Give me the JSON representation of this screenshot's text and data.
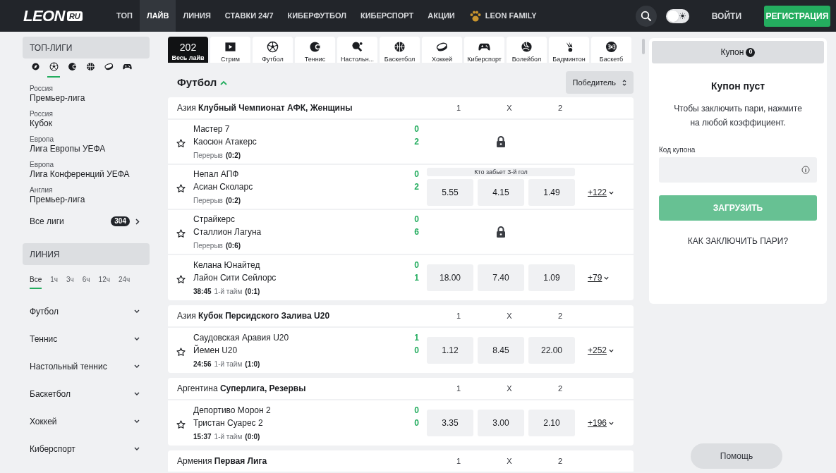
{
  "header": {
    "logo": "LEON",
    "logo_badge": "RU",
    "nav": [
      {
        "label": "ТОП",
        "selected": false
      },
      {
        "label": "ЛАЙВ",
        "selected": true
      },
      {
        "label": "ЛИНИЯ",
        "selected": false
      },
      {
        "label": "СТАВКИ 24/7",
        "selected": false
      },
      {
        "label": "КИБЕРФУТБОЛ",
        "selected": false
      },
      {
        "label": "КИБЕРСПОРТ",
        "selected": false
      },
      {
        "label": "АКЦИИ",
        "selected": false
      },
      {
        "label": "LEON FAMILY",
        "selected": false,
        "kind": "family"
      }
    ],
    "theme_toggle": {
      "on": false
    },
    "login": "ВОЙТИ",
    "register": "РЕГИСТРАЦИЯ"
  },
  "sidebar": {
    "top_leagues_title": "ТОП-ЛИГИ",
    "sport_filter": [
      {
        "kind": "other",
        "selected": false
      },
      {
        "kind": "football",
        "selected": true
      },
      {
        "kind": "tennis",
        "selected": false
      },
      {
        "kind": "basketball",
        "selected": false
      },
      {
        "kind": "hockey",
        "selected": false
      },
      {
        "kind": "esports",
        "selected": false
      }
    ],
    "leagues": [
      {
        "country": "Россия",
        "name": "Премьер-лига"
      },
      {
        "country": "Россия",
        "name": "Кубок"
      },
      {
        "country": "Европа",
        "name": "Лига Европы УЕФА"
      },
      {
        "country": "Европа",
        "name": "Лига Конференций УЕФА"
      },
      {
        "country": "Англия",
        "name": "Премьер-лига"
      }
    ],
    "all_leagues": {
      "label": "Все лиги",
      "count": "304"
    },
    "line_title": "ЛИНИЯ",
    "periods": [
      {
        "label": "Все",
        "selected": true
      },
      {
        "label": "1ч",
        "selected": false
      },
      {
        "label": "3ч",
        "selected": false
      },
      {
        "label": "6ч",
        "selected": false
      },
      {
        "label": "12ч",
        "selected": false
      },
      {
        "label": "24ч",
        "selected": false
      }
    ],
    "sports": [
      {
        "label": "Футбол",
        "expanded": false
      },
      {
        "label": "Теннис",
        "expanded": false
      },
      {
        "label": "Настольный теннис",
        "expanded": false
      },
      {
        "label": "Баскетбол",
        "expanded": false
      },
      {
        "label": "Хоккей",
        "expanded": false
      },
      {
        "label": "Киберспорт",
        "expanded": false
      }
    ]
  },
  "sport_tabs": [
    {
      "kind": "all",
      "count": "202",
      "label": "Весь лайв",
      "selected": true
    },
    {
      "kind": "stream",
      "label": "Стрим",
      "selected": false
    },
    {
      "kind": "football",
      "label": "Футбол",
      "selected": false
    },
    {
      "kind": "tennis",
      "label": "Теннис",
      "selected": false
    },
    {
      "kind": "tabletennis",
      "label": "Настольн...",
      "selected": false
    },
    {
      "kind": "basketball",
      "label": "Баскетбол",
      "selected": false
    },
    {
      "kind": "hockey",
      "label": "Хоккей",
      "selected": false
    },
    {
      "kind": "esports",
      "label": "Киберспорт",
      "selected": false
    },
    {
      "kind": "volleyball",
      "label": "Волейбол",
      "selected": false
    },
    {
      "kind": "badminton",
      "label": "Бадминтон",
      "selected": false
    },
    {
      "kind": "threebythree",
      "label": "Баскетб",
      "selected": false
    }
  ],
  "section": {
    "title": "Футбол",
    "expanded": true,
    "market_select": "Победитель"
  },
  "leagues": [
    {
      "country": "Азия",
      "name": "Клубный Чемпионат АФК, Женщины",
      "columns": [
        "1",
        "X",
        "2"
      ],
      "matches": [
        {
          "team1": "Мастер 7",
          "team2": "Каосюн Атакерс",
          "score1": "0",
          "score2": "2",
          "period": "Перерыв",
          "period_score": "(0:2)",
          "locked": true
        },
        {
          "team1": "Непал АПФ",
          "team2": "Асиан Сколарс",
          "score1": "0",
          "score2": "2",
          "period": "Перерыв",
          "period_score": "(0:2)",
          "locked": false,
          "market": "Кто забьет 3-й гол",
          "odds": [
            "5.55",
            "4.15",
            "1.49"
          ],
          "more": "+122"
        },
        {
          "team1": "Страйкерс",
          "team2": "Сталлион Лагуна",
          "score1": "0",
          "score2": "6",
          "period": "Перерыв",
          "period_score": "(0:6)",
          "locked": true
        },
        {
          "team1": "Келана Юнайтед",
          "team2": "Лайон Сити Сейлорс",
          "score1": "0",
          "score2": "1",
          "time": "38:45",
          "period": "1-й тайм",
          "period_score": "(0:1)",
          "locked": false,
          "odds": [
            "18.00",
            "7.40",
            "1.09"
          ],
          "more": "+79"
        }
      ]
    },
    {
      "country": "Азия",
      "name": "Кубок Персидского Залива U20",
      "columns": [
        "1",
        "X",
        "2"
      ],
      "matches": [
        {
          "team1": "Саудовская Аравия U20",
          "team2": "Йемен U20",
          "score1": "1",
          "score2": "0",
          "time": "24:56",
          "period": "1-й тайм",
          "period_score": "(1:0)",
          "locked": false,
          "odds": [
            "1.12",
            "8.45",
            "22.00"
          ],
          "more": "+252"
        }
      ]
    },
    {
      "country": "Аргентина",
      "name": "Суперлига, Резервы",
      "columns": [
        "1",
        "X",
        "2"
      ],
      "matches": [
        {
          "team1": "Депортиво Морон 2",
          "team2": "Тристан Суарес 2",
          "score1": "0",
          "score2": "0",
          "time": "15:37",
          "period": "1-й тайм",
          "period_score": "(0:0)",
          "locked": false,
          "odds": [
            "3.35",
            "3.00",
            "2.10"
          ],
          "more": "+196"
        }
      ]
    },
    {
      "country": "Армения",
      "name": "Первая Лига",
      "columns": [
        "1",
        "X",
        "2"
      ]
    }
  ],
  "coupon": {
    "tab": "Купон",
    "count": "0",
    "title": "Купон пуст",
    "text": "Чтобы заключить пари, нажмите на любой коэффициент.",
    "code_label": "Код купона",
    "load_button": "ЗАГРУЗИТЬ",
    "how_link": "КАК ЗАКЛЮЧИТЬ ПАРИ?"
  },
  "help_button": "Помощь"
}
